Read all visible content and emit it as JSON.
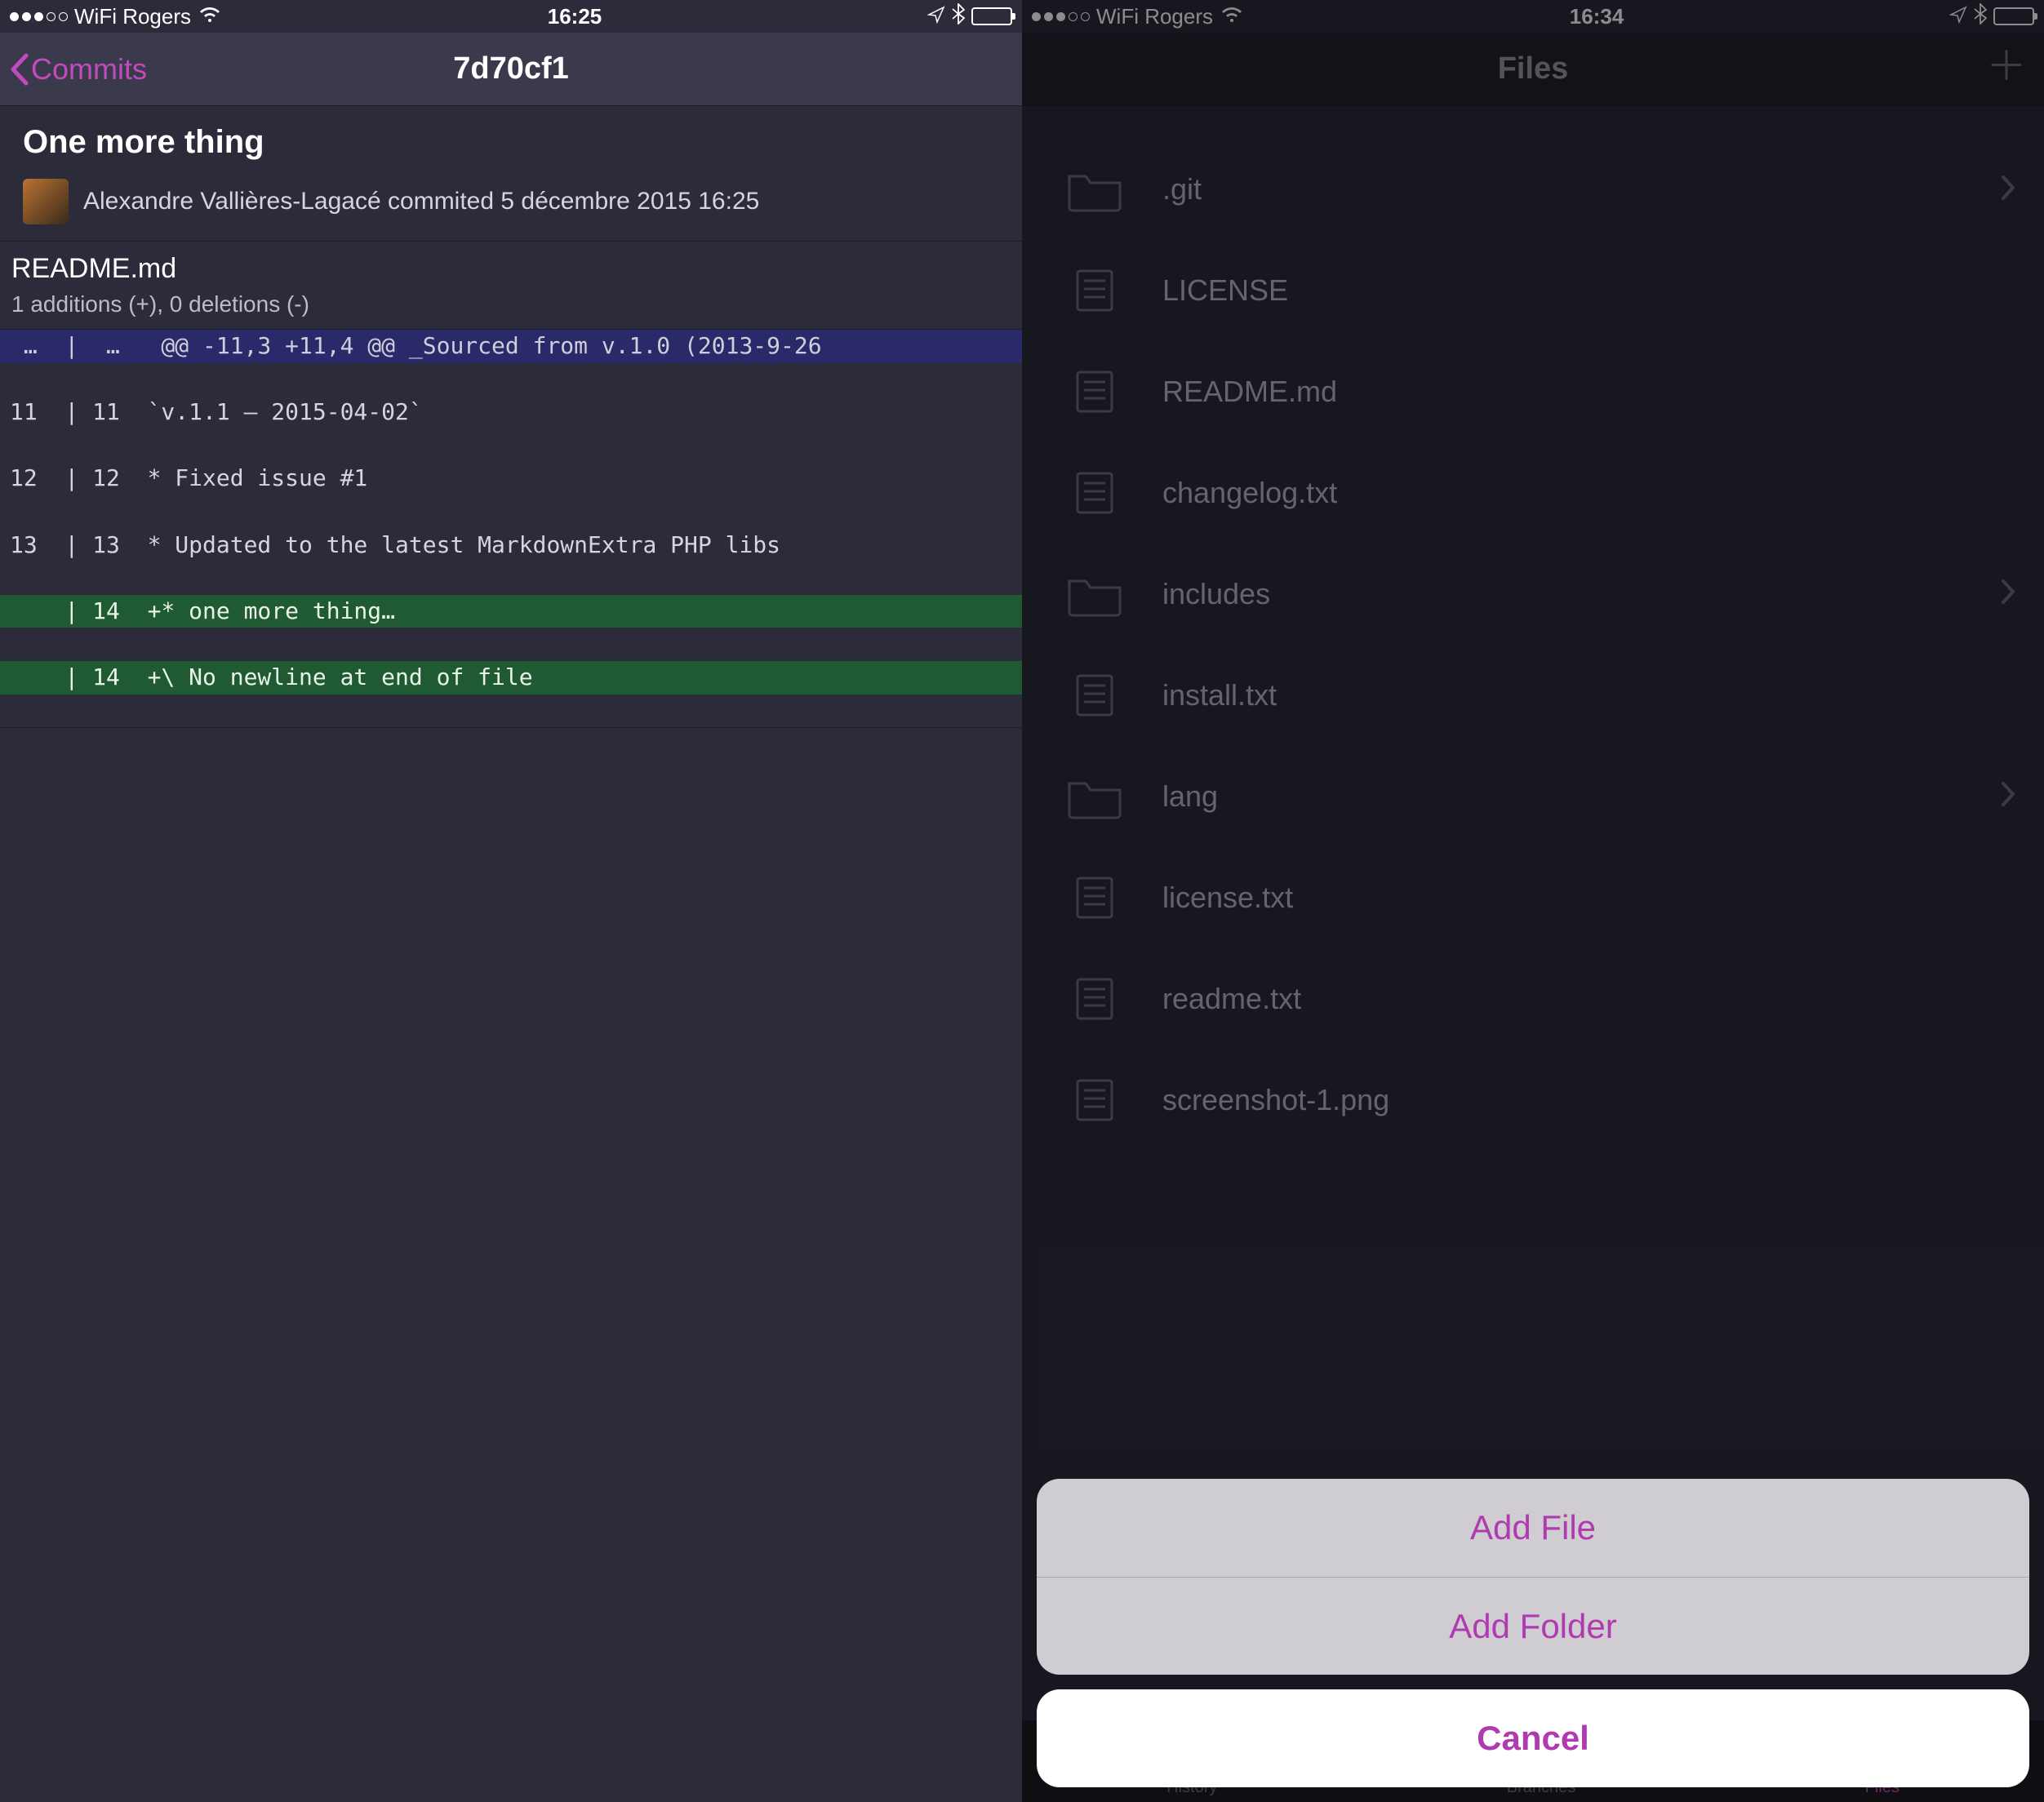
{
  "left": {
    "status": {
      "carrier": "WiFi Rogers",
      "time": "16:25"
    },
    "nav": {
      "back_label": "Commits",
      "title": "7d70cf1"
    },
    "commit": {
      "message": "One more thing",
      "author": "Alexandre Vallières-Lagacé",
      "action": "commited",
      "date": "5 décembre 2015 16:25"
    },
    "file": {
      "name": "README.md",
      "stats": "1 additions (+), 0 deletions (-)"
    },
    "diff": [
      {
        "kind": "hunk",
        "old": "…",
        "new": "…",
        "text": "@@ -11,3 +11,4 @@ _Sourced from v.1.0 (2013-9-26"
      },
      {
        "kind": "ctx",
        "old": "11",
        "new": "11",
        "text": "`v.1.1 — 2015-04-02`"
      },
      {
        "kind": "ctx",
        "old": "12",
        "new": "12",
        "text": "* Fixed issue #1"
      },
      {
        "kind": "ctx",
        "old": "13",
        "new": "13",
        "text": "* Updated to the latest MarkdownExtra PHP libs"
      },
      {
        "kind": "add",
        "old": "",
        "new": "14",
        "text": "+* one more thing…"
      },
      {
        "kind": "add",
        "old": "",
        "new": "14",
        "text": "+\\ No newline at end of file"
      }
    ]
  },
  "right": {
    "status": {
      "carrier": "WiFi Rogers",
      "time": "16:34"
    },
    "nav": {
      "title": "Files"
    },
    "files": [
      {
        "name": ".git",
        "type": "folder",
        "disclosure": true
      },
      {
        "name": "LICENSE",
        "type": "file",
        "disclosure": false
      },
      {
        "name": "README.md",
        "type": "file",
        "disclosure": false
      },
      {
        "name": "changelog.txt",
        "type": "file",
        "disclosure": false
      },
      {
        "name": "includes",
        "type": "folder",
        "disclosure": true
      },
      {
        "name": "install.txt",
        "type": "file",
        "disclosure": false
      },
      {
        "name": "lang",
        "type": "folder",
        "disclosure": true
      },
      {
        "name": "license.txt",
        "type": "file",
        "disclosure": false
      },
      {
        "name": "readme.txt",
        "type": "file",
        "disclosure": false
      },
      {
        "name": "screenshot-1.png",
        "type": "file",
        "disclosure": false
      }
    ],
    "tabs": [
      {
        "label": "History",
        "active": false
      },
      {
        "label": "Branches",
        "active": false
      },
      {
        "label": "Files",
        "active": true
      }
    ],
    "action_sheet": {
      "options": [
        "Add File",
        "Add Folder"
      ],
      "cancel": "Cancel"
    }
  },
  "colors": {
    "accent": "#c14bbd"
  }
}
